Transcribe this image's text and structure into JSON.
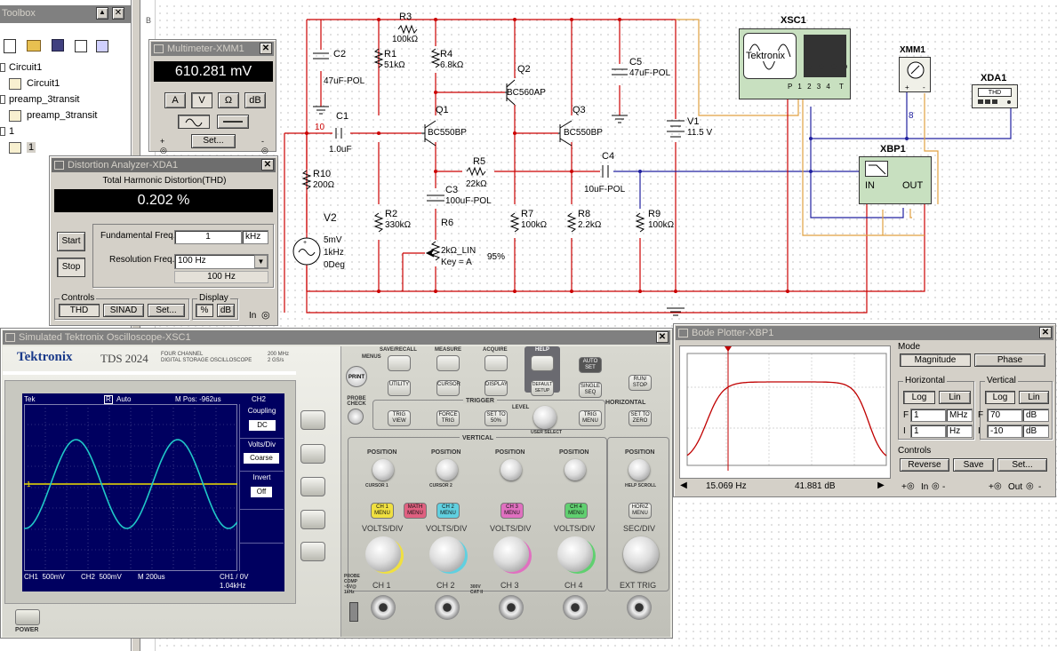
{
  "toolbox": {
    "title": "Toolbox",
    "tree": [
      {
        "label": "Circuit1"
      },
      {
        "label": "Circuit1"
      },
      {
        "label": "preamp_3transit"
      },
      {
        "label": "preamp_3transit"
      },
      {
        "label": "1"
      },
      {
        "label": "1"
      }
    ]
  },
  "multimeter": {
    "title": "Multimeter-XMM1",
    "reading": "610.281 mV",
    "buttons": [
      "A",
      "V",
      "Ω",
      "dB"
    ],
    "set_label": "Set..."
  },
  "distortion": {
    "title": "Distortion Analyzer-XDA1",
    "heading": "Total Harmonic Distortion(THD)",
    "reading": "0.202 %",
    "start_label": "Start",
    "stop_label": "Stop",
    "fund_label": "Fundamental Freq.",
    "fund_value": "1",
    "fund_unit": "kHz",
    "res_label": "Resolution Freq.",
    "res_value": "100 Hz",
    "res_display": "100 Hz",
    "controls_label": "Controls",
    "display_label": "Display",
    "thd_label": "THD",
    "sinad_label": "SINAD",
    "set_label": "Set...",
    "pct_label": "%",
    "db_label": "dB",
    "in_label": "In"
  },
  "schematic": {
    "components": {
      "r3": "R3",
      "r3v": "100kΩ",
      "r4": "R4",
      "r4v": "6.8kΩ",
      "r1": "R1",
      "r1v": "51kΩ",
      "c2": "C2",
      "c2v": "47uF-POL",
      "c1": "C1",
      "c1v": "1.0uF",
      "q1": "Q1",
      "q1v": "BC550BP",
      "q2": "Q2",
      "q2v": "BC560AP",
      "q3": "Q3",
      "q3v": "BC550BP",
      "c5": "C5",
      "c5v": "47uF-POL",
      "v1": "V1",
      "v1v": "11.5 V",
      "r10": "R10",
      "r10v": "200Ω",
      "node10": "10",
      "r5": "R5",
      "r5v": "22kΩ",
      "c4": "C4",
      "c4v": "10uF-POL",
      "c3": "C3",
      "c3v": "100uF-POL",
      "r6": "R6",
      "r6v": "2kΩ_LIN",
      "r6k": "Key = A",
      "r6p": "95%",
      "v2": "V2",
      "v2a": "5mV",
      "v2b": "1kHz",
      "v2c": "0Deg",
      "r2": "R2",
      "r2v": "330kΩ",
      "r7": "R7",
      "r7v": "100kΩ",
      "r8": "R8",
      "r8v": "2.2kΩ",
      "r9": "R9",
      "r9v": "100kΩ",
      "xsc1": "XSC1",
      "xsc1_brand": "Tektronix",
      "xsc1_pins": "P 1 2 3 4",
      "xsc1_t": "T",
      "xmm1": "XMM1",
      "xda1": "XDA1",
      "xda1_thd": "THD",
      "xbp1": "XBP1",
      "xbp1_in": "IN",
      "xbp1_out": "OUT",
      "node8": "8"
    }
  },
  "oscilloscope": {
    "title": "Simulated Tektronix Oscilloscope-XSC1",
    "brand": "Tektronix",
    "model": "TDS 2024",
    "model_sub1": "FOUR CHANNEL",
    "model_sub2": "DIGITAL STORAGE OSCILLOSCOPE",
    "spec1": "200 MHz",
    "spec2": "2 GS/s",
    "screen": {
      "tek": "Tek",
      "trig_state": "R",
      "mode": "Auto",
      "mpos": "M Pos: -962us",
      "ch": "CH2",
      "coupling_label": "Coupling",
      "coupling_value": "DC",
      "voltsdiv_label": "Volts/Div",
      "voltsdiv_value": "Coarse",
      "invert_label": "Invert",
      "invert_value": "Off",
      "ch1_scale": "CH1  500mV",
      "ch2_scale": "CH2  500mV",
      "timebase": "M 200us",
      "trig_info": "CH1 / 0V",
      "freq": "1.04kHz",
      "marker": "1"
    },
    "buttons": {
      "print": "PRINT",
      "menus": "MENUS",
      "save_recall": "SAVE/RECALL",
      "measure": "MEASURE",
      "acquire": "ACQUIRE",
      "help": "HELP",
      "utility": "UTILITY",
      "cursor": "CURSOR",
      "display": "DISPLAY",
      "default_setup": "DEFAULT SETUP",
      "auto_set": "AUTO SET",
      "single_seq": "SINGLE SEQ",
      "run_stop": "RUN/ STOP",
      "probe_check": "PROBE CHECK",
      "trigger": "TRIGGER",
      "level": "LEVEL",
      "trig_view": "TRIG VIEW",
      "force_trig": "FORCE TRIG",
      "set_to_50": "SET TO 50%",
      "user_select": "USER SELECT",
      "trig_menu": "TRIG MENU",
      "horizontal": "HORIZONTAL",
      "set_to_zero": "SET TO ZERO",
      "vertical": "VERTICAL",
      "position": "POSITION",
      "cursor1": "CURSOR 1",
      "cursor2": "CURSOR 2",
      "help_scroll": "HELP SCROLL",
      "ch1_menu": "CH 1 MENU",
      "math_menu": "MATH MENU",
      "ch2_menu": "CH 2 MENU",
      "ch3_menu": "CH 3 MENU",
      "ch4_menu": "CH 4 MENU",
      "horiz_menu": "HORIZ MENU",
      "volts_div": "VOLTS/DIV",
      "sec_div": "SEC/DIV",
      "ch1": "CH 1",
      "ch2": "CH 2",
      "ch3": "CH 3",
      "ch4": "CH 4",
      "ext_trig": "EXT TRIG",
      "probe_comp": "PROBE COMP ~5V@ 1kHz",
      "cat": "300V CAT II",
      "power": "POWER"
    }
  },
  "bode": {
    "title": "Bode Plotter-XBP1",
    "mode_label": "Mode",
    "magnitude_label": "Magnitude",
    "phase_label": "Phase",
    "horizontal_label": "Horizontal",
    "vertical_label": "Vertical",
    "log_label": "Log",
    "lin_label": "Lin",
    "h_f_label": "F",
    "h_f_value": "1",
    "h_f_unit": "MHz",
    "h_i_label": "I",
    "h_i_value": "1",
    "h_i_unit": "Hz",
    "v_f_label": "F",
    "v_f_value": "70",
    "v_f_unit": "dB",
    "v_i_label": "I",
    "v_i_value": "-10",
    "v_i_unit": "dB",
    "controls_label": "Controls",
    "reverse_label": "Reverse",
    "save_label": "Save",
    "set_label": "Set...",
    "cursor_freq": "15.069  Hz",
    "cursor_gain": "41.881 dB",
    "in_label": "In",
    "out_label": "Out",
    "plus": "+",
    "minus": "-",
    "curve": {
      "color": "#c00000"
    }
  },
  "colors": {
    "wire": "#cc0000",
    "wire_blue": "#2020a0",
    "wire_orange": "#e0a040",
    "trace_yellow": "#f0e000",
    "trace_cyan": "#20c8c8"
  }
}
